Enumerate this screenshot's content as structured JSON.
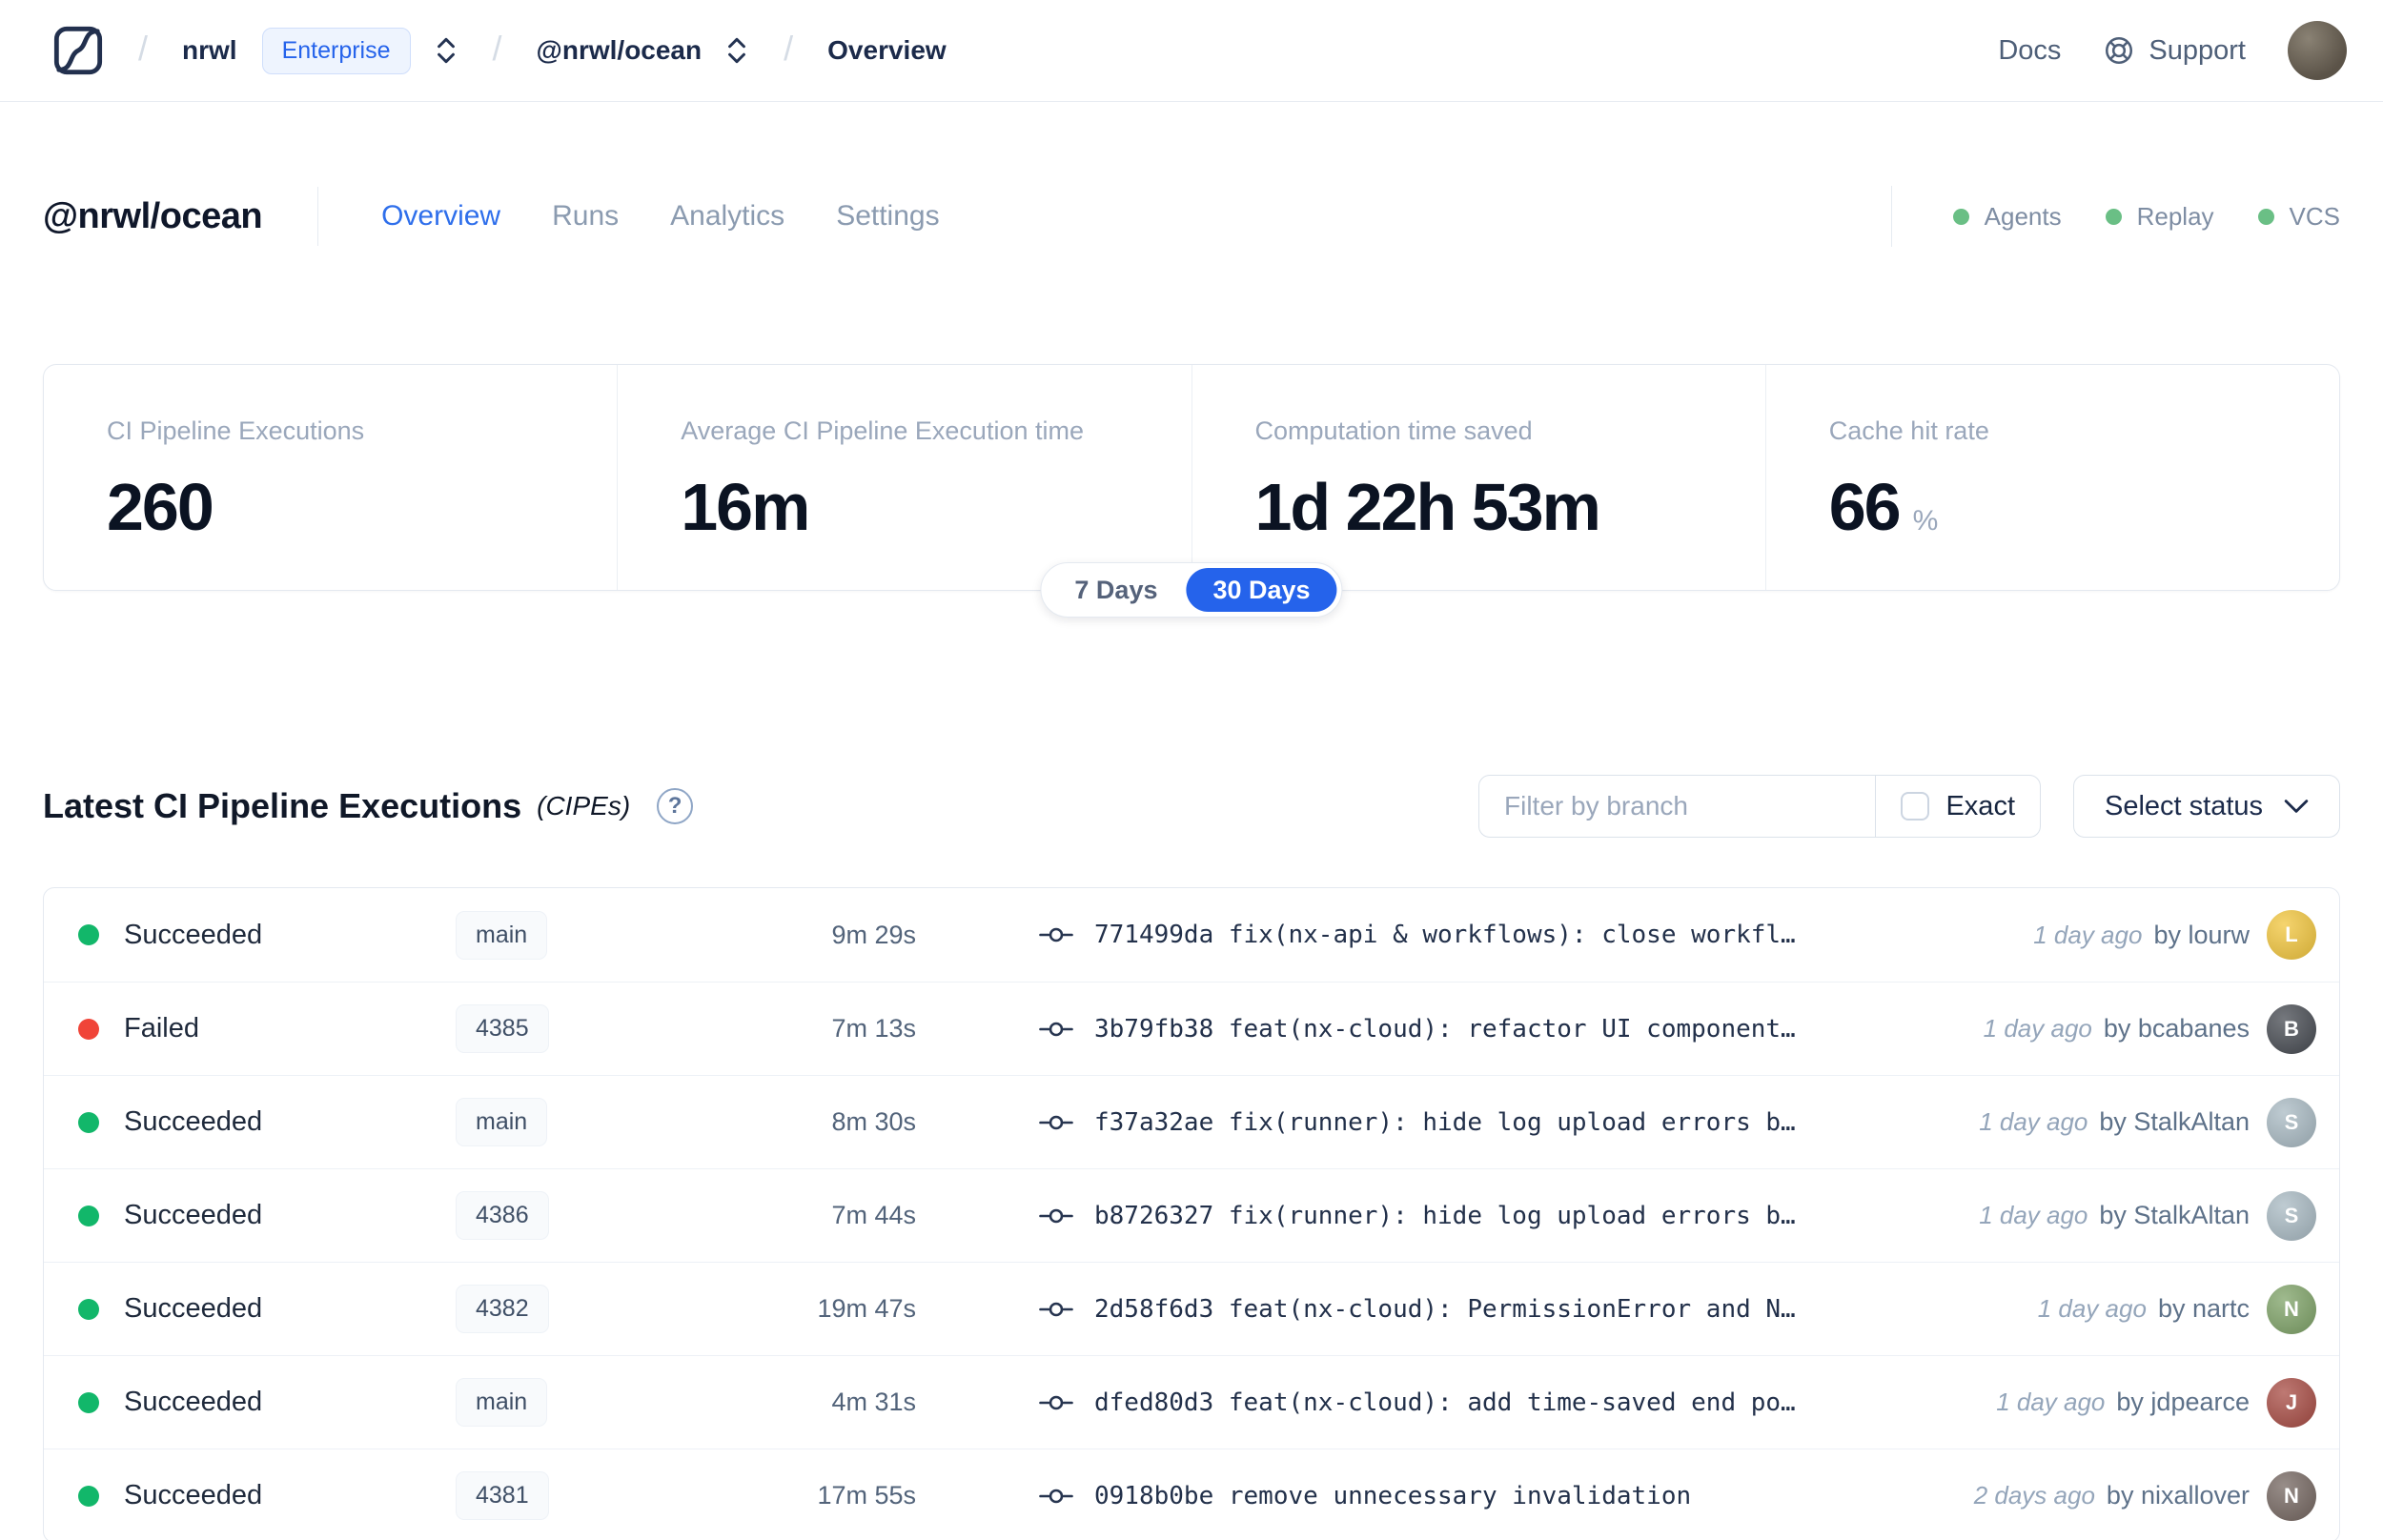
{
  "navbar": {
    "separator": "/",
    "org": "nrwl",
    "org_badge": "Enterprise",
    "workspace": "@nrwl/ocean",
    "page": "Overview",
    "docs_label": "Docs",
    "support_label": "Support",
    "avatar_color": "#5b5348"
  },
  "header": {
    "title": "@nrwl/ocean",
    "tabs": [
      {
        "label": "Overview",
        "active": true
      },
      {
        "label": "Runs",
        "active": false
      },
      {
        "label": "Analytics",
        "active": false
      },
      {
        "label": "Settings",
        "active": false
      }
    ],
    "services": [
      {
        "label": "Agents"
      },
      {
        "label": "Replay"
      },
      {
        "label": "VCS"
      }
    ]
  },
  "stats": {
    "cards": [
      {
        "label": "CI Pipeline Executions",
        "value": "260",
        "unit": ""
      },
      {
        "label": "Average CI Pipeline Execution time",
        "value": "16m",
        "unit": ""
      },
      {
        "label": "Computation time saved",
        "value": "1d 22h 53m",
        "unit": ""
      },
      {
        "label": "Cache hit rate",
        "value": "66",
        "unit": "%"
      }
    ],
    "toggle": {
      "options": [
        "7 Days",
        "30 Days"
      ],
      "selected": "30 Days"
    }
  },
  "cipe": {
    "title": "Latest CI Pipeline Executions",
    "suffix": "(CIPEs)",
    "help_glyph": "?",
    "filter_placeholder": "Filter by branch",
    "exact_label": "Exact",
    "exact_checked": false,
    "select_status_label": "Select status",
    "rows": [
      {
        "status": "Succeeded",
        "status_color": "#12b76a",
        "branch": "main",
        "duration": "9m 29s",
        "commit": "771499da fix(nx-api & workflows): close workfl…",
        "time": "1 day ago",
        "author": "by lourw",
        "avatar_initial": "L",
        "avatar_color": "#f2c63e"
      },
      {
        "status": "Failed",
        "status_color": "#f04438",
        "branch": "4385",
        "duration": "7m 13s",
        "commit": "3b79fb38 feat(nx-cloud): refactor UI component…",
        "time": "1 day ago",
        "author": "by bcabanes",
        "avatar_initial": "B",
        "avatar_color": "#474b52"
      },
      {
        "status": "Succeeded",
        "status_color": "#12b76a",
        "branch": "main",
        "duration": "8m 30s",
        "commit": "f37a32ae fix(runner): hide log upload errors b…",
        "time": "1 day ago",
        "author": "by StalkAltan",
        "avatar_initial": "S",
        "avatar_color": "#a9bac3"
      },
      {
        "status": "Succeeded",
        "status_color": "#12b76a",
        "branch": "4386",
        "duration": "7m 44s",
        "commit": "b8726327 fix(runner): hide log upload errors b…",
        "time": "1 day ago",
        "author": "by StalkAltan",
        "avatar_initial": "S",
        "avatar_color": "#a9bac3"
      },
      {
        "status": "Succeeded",
        "status_color": "#12b76a",
        "branch": "4382",
        "duration": "19m 47s",
        "commit": "2d58f6d3 feat(nx-cloud): PermissionError and N…",
        "time": "1 day ago",
        "author": "by nartc",
        "avatar_initial": "N",
        "avatar_color": "#7fa368"
      },
      {
        "status": "Succeeded",
        "status_color": "#12b76a",
        "branch": "main",
        "duration": "4m 31s",
        "commit": "dfed80d3 feat(nx-cloud): add time-saved end po…",
        "time": "1 day ago",
        "author": "by jdpearce",
        "avatar_initial": "J",
        "avatar_color": "#a84c44"
      },
      {
        "status": "Succeeded",
        "status_color": "#12b76a",
        "branch": "4381",
        "duration": "17m 55s",
        "commit": "0918b0be remove unnecessary invalidation",
        "time": "2 days ago",
        "author": "by nixallover",
        "avatar_initial": "N",
        "avatar_color": "#756761"
      }
    ]
  },
  "colors": {
    "accent_blue": "#2563eb",
    "success_green": "#12b76a",
    "failed_red": "#f04438",
    "service_green": "#6abf85"
  }
}
